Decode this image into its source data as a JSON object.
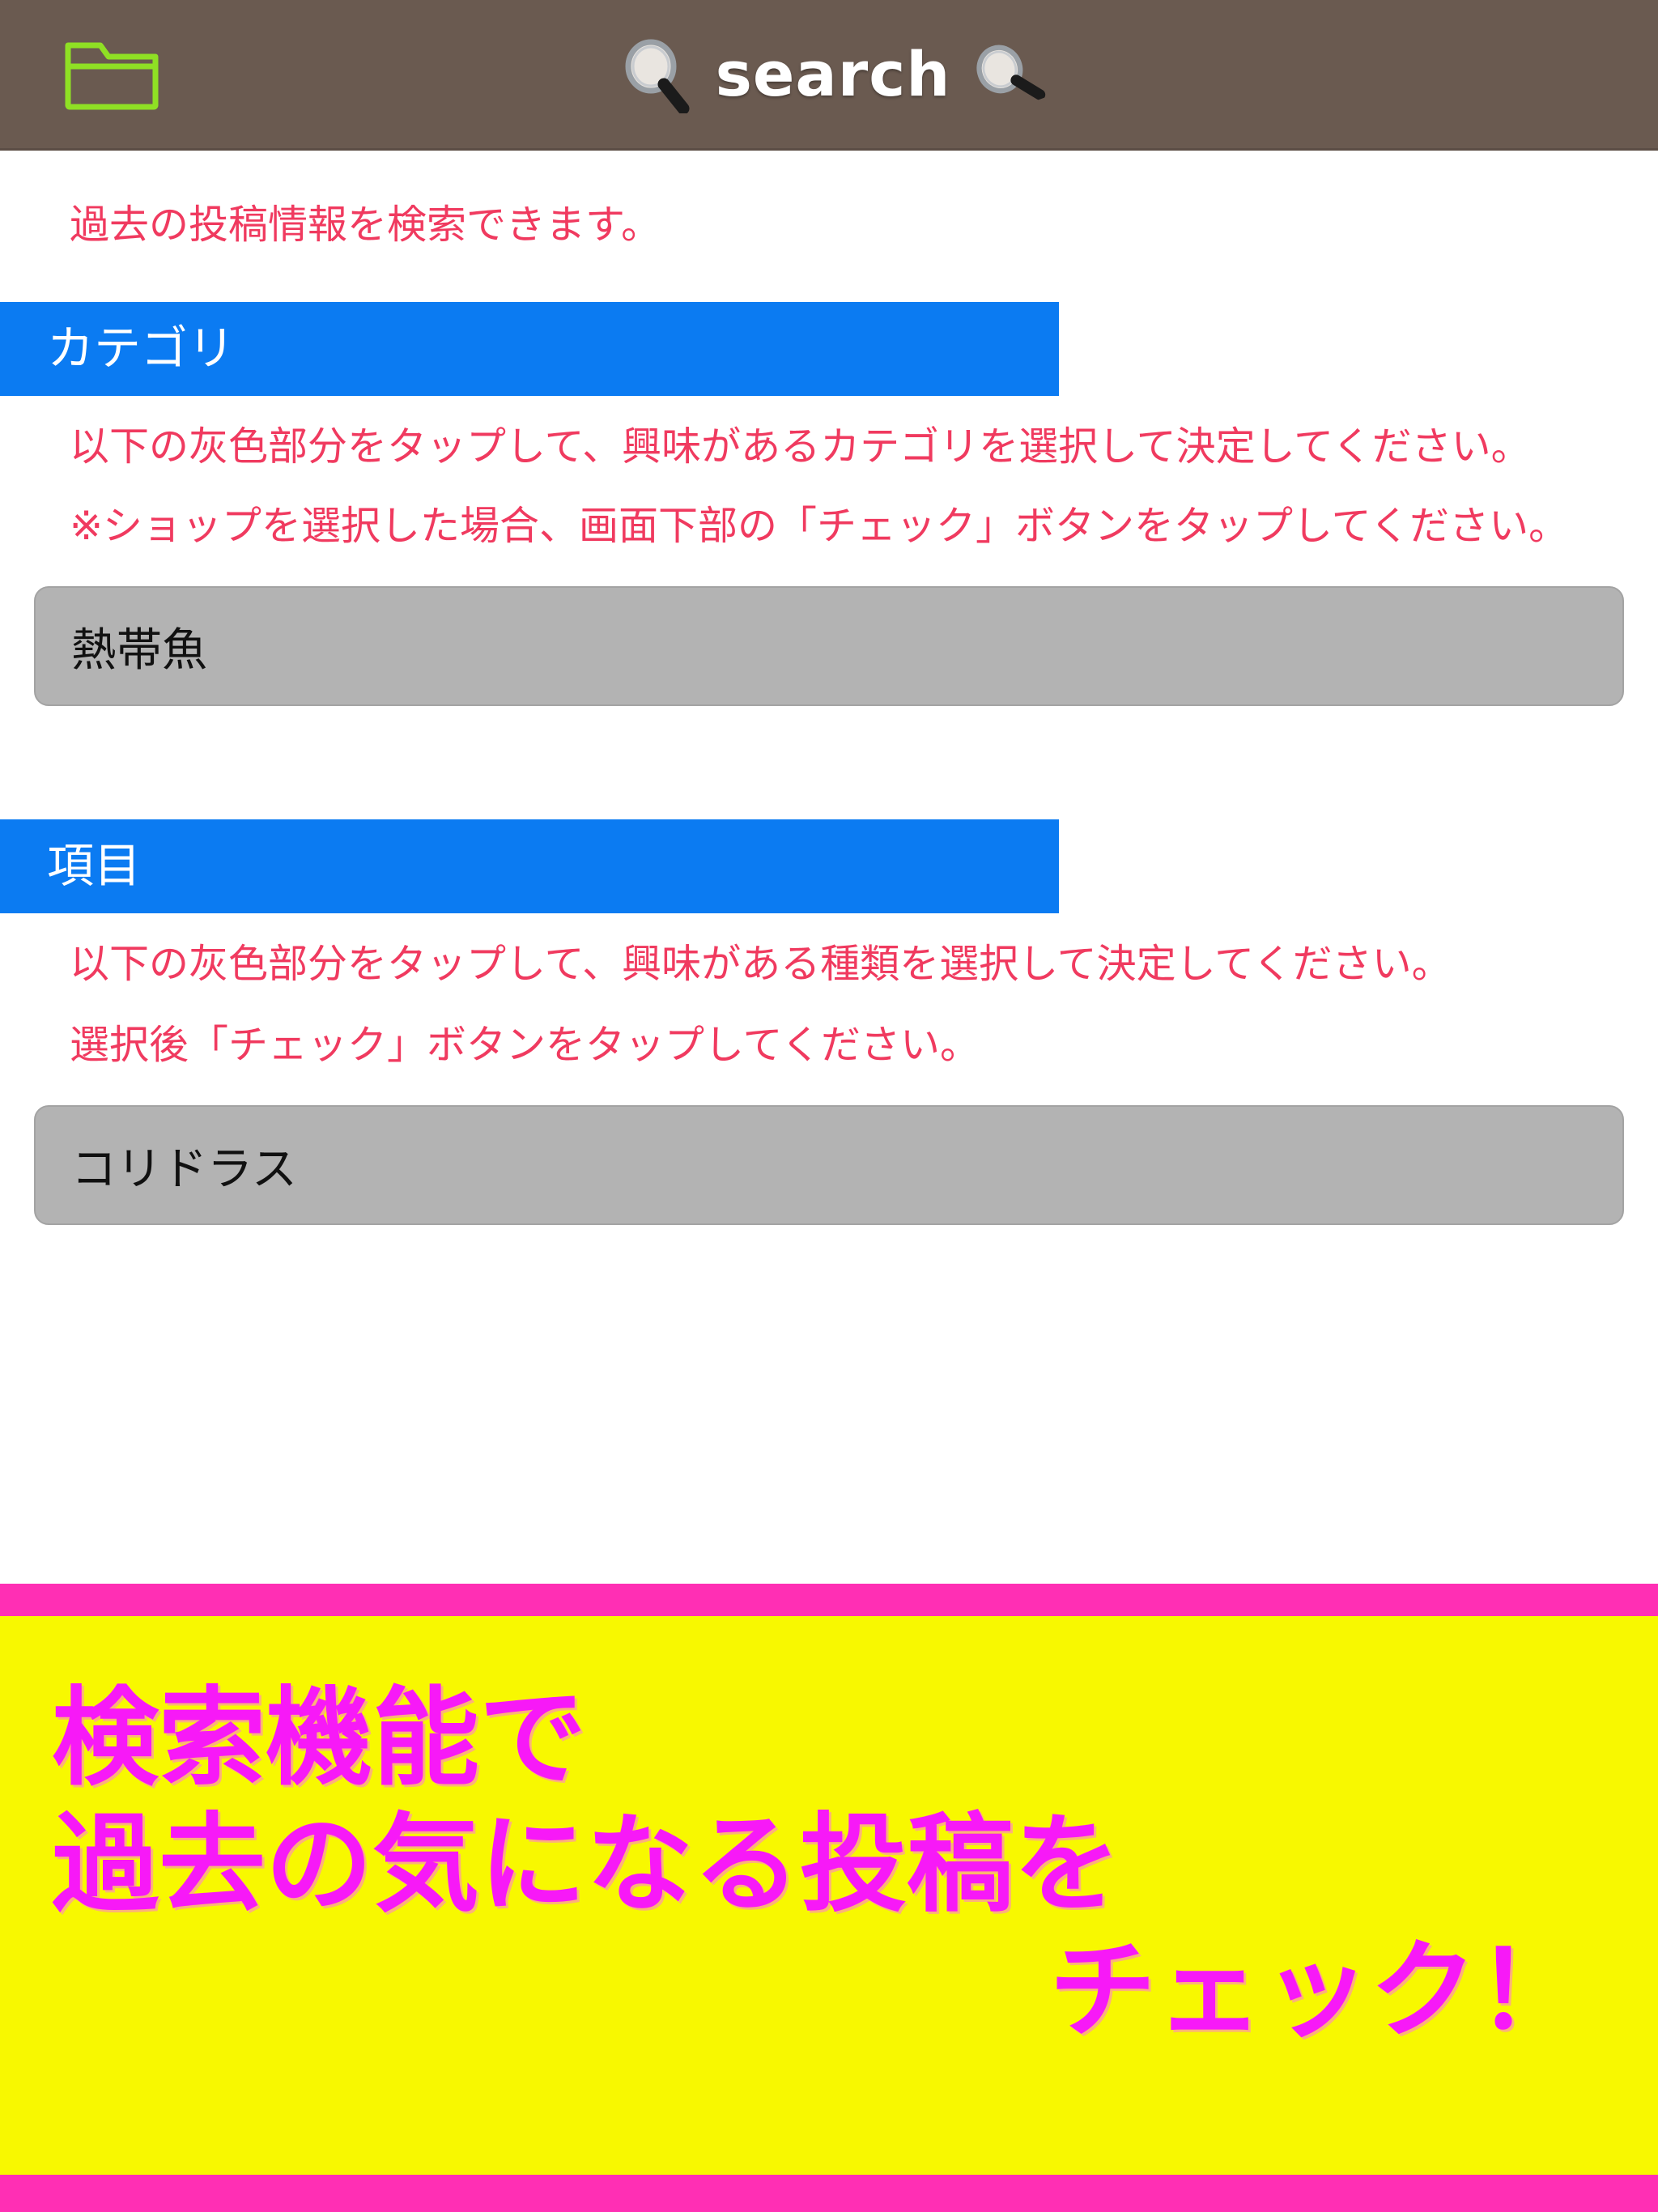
{
  "header": {
    "title": "search",
    "folder_icon": "folder-icon",
    "left_magnifier_icon": "magnifying-glass-icon",
    "right_magnifier_icon": "magnifying-glass-icon",
    "background_color": "#6a5a50",
    "title_color": "#ffffff",
    "folder_icon_color": "#8fe024"
  },
  "intro": {
    "text": "過去の投稿情報を検索できます。",
    "color": "#f03a5f"
  },
  "sections": [
    {
      "banner_label": "カテゴリ",
      "banner_color": "#0b7bf2",
      "paragraphs": [
        "以下の灰色部分をタップして、興味があるカテゴリを選択して決定してください。",
        "※ショップを選択した場合、画面下部の「チェック」ボタンをタップしてください。"
      ],
      "select_value": "熱帯魚"
    },
    {
      "banner_label": "項目",
      "banner_color": "#0b7bf2",
      "paragraphs": [
        "以下の灰色部分をタップして、興味がある種類を選択して決定してください。",
        "選択後「チェック」ボタンをタップしてください。"
      ],
      "select_value": "コリドラス"
    }
  ],
  "promo": {
    "line1": "検索機能で",
    "line2": "過去の気になる投稿を",
    "line3": "チェック！",
    "text_color": "#f719f7",
    "background_color": "#f8f800",
    "border_color": "#ff2fb4"
  }
}
